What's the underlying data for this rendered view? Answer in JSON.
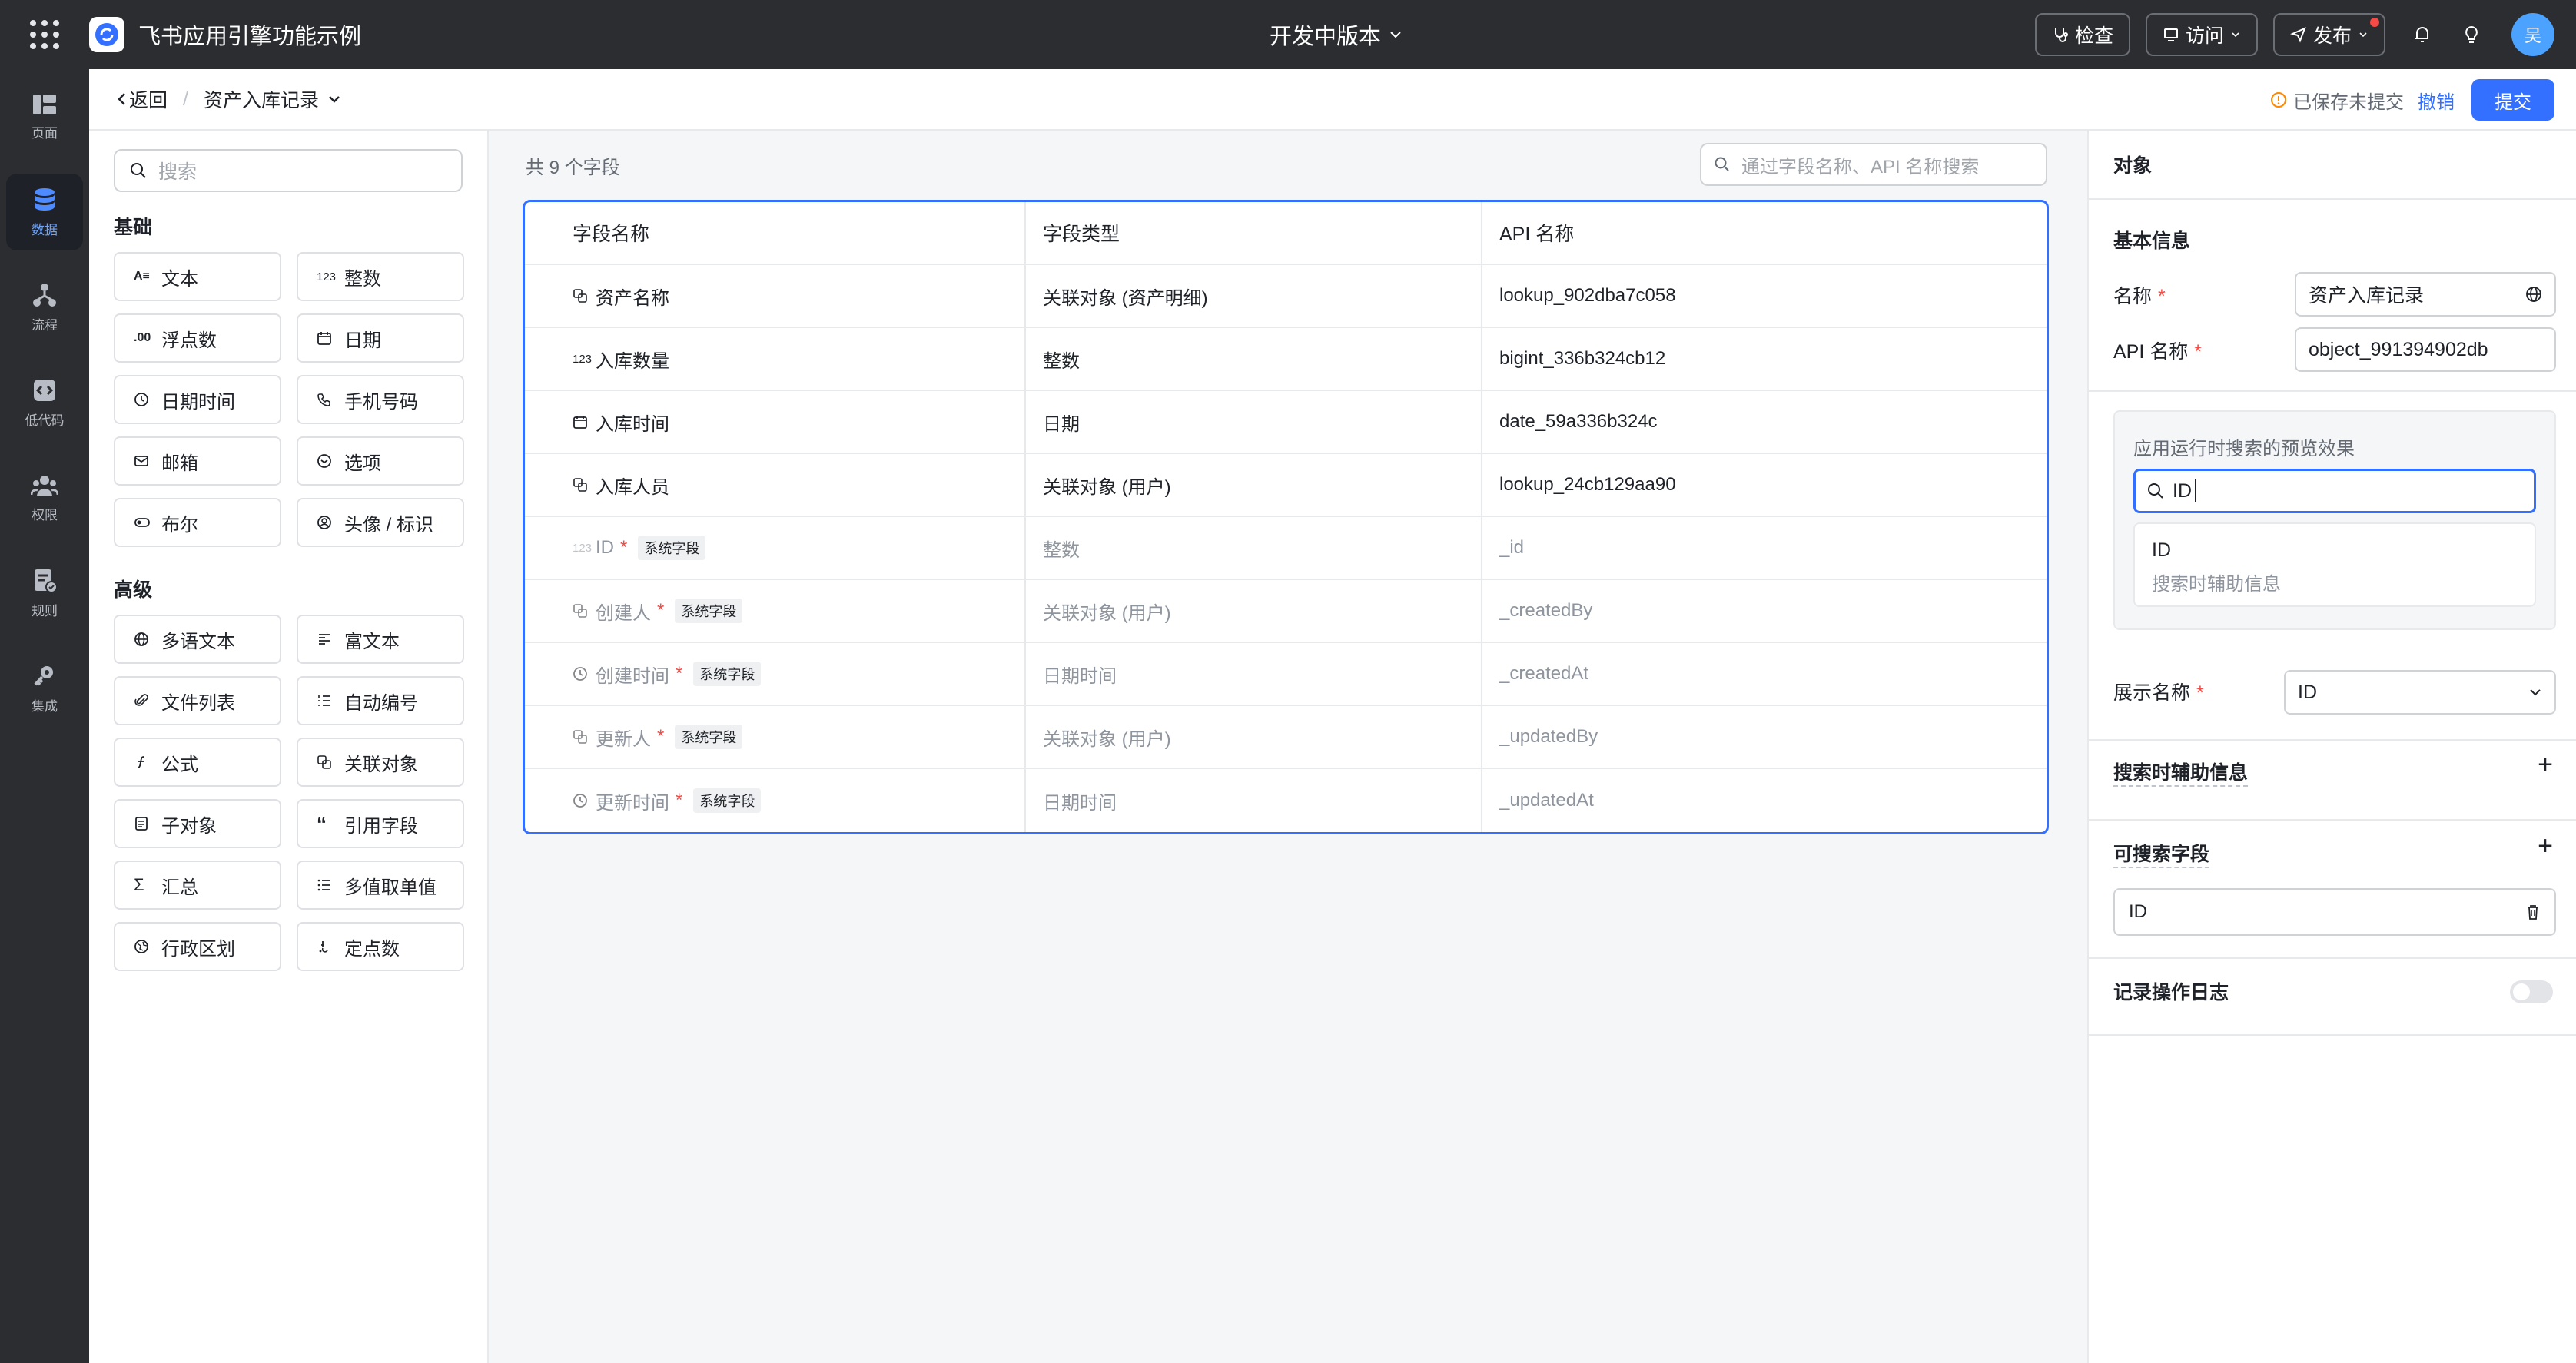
{
  "app": {
    "title": "飞书应用引擎功能示例",
    "version_label": "开发中版本",
    "buttons": {
      "inspect": "检查",
      "visit": "访问",
      "publish": "发布"
    },
    "avatar_text": "吴"
  },
  "rail": [
    {
      "label": "页面",
      "icon": "pages-icon"
    },
    {
      "label": "数据",
      "icon": "database-icon",
      "active": true
    },
    {
      "label": "流程",
      "icon": "flow-icon"
    },
    {
      "label": "低代码",
      "icon": "code-icon"
    },
    {
      "label": "权限",
      "icon": "users-icon"
    },
    {
      "label": "规则",
      "icon": "rules-icon"
    },
    {
      "label": "集成",
      "icon": "key-icon"
    }
  ],
  "breadcrumb": {
    "back": "返回",
    "separator": "/",
    "current": "资产入库记录",
    "saved_status": "已保存未提交",
    "revoke": "撤销",
    "submit": "提交"
  },
  "field_panel": {
    "search_placeholder": "搜索",
    "basic_title": "基础",
    "basic": [
      {
        "label": "文本",
        "icon": "A≡"
      },
      {
        "label": "整数",
        "icon": "123"
      },
      {
        "label": "浮点数",
        "icon": ".00"
      },
      {
        "label": "日期",
        "icon": "calendar"
      },
      {
        "label": "日期时间",
        "icon": "clock"
      },
      {
        "label": "手机号码",
        "icon": "phone"
      },
      {
        "label": "邮箱",
        "icon": "mail"
      },
      {
        "label": "选项",
        "icon": "option"
      },
      {
        "label": "布尔",
        "icon": "toggle"
      },
      {
        "label": "头像 / 标识",
        "icon": "avatar"
      }
    ],
    "advanced_title": "高级",
    "advanced": [
      {
        "label": "多语文本",
        "icon": "globe"
      },
      {
        "label": "富文本",
        "icon": "richtext"
      },
      {
        "label": "文件列表",
        "icon": "clip"
      },
      {
        "label": "自动编号",
        "icon": "list-num"
      },
      {
        "label": "公式",
        "icon": "formula"
      },
      {
        "label": "关联对象",
        "icon": "link"
      },
      {
        "label": "子对象",
        "icon": "sub"
      },
      {
        "label": "引用字段",
        "icon": "quote"
      },
      {
        "label": "汇总",
        "icon": "sigma"
      },
      {
        "label": "多值取单值",
        "icon": "list"
      },
      {
        "label": "行政区划",
        "icon": "region"
      },
      {
        "label": "定点数",
        "icon": "fixed"
      }
    ]
  },
  "table": {
    "count_label": "共 9 个字段",
    "search_placeholder": "通过字段名称、API 名称搜索",
    "headers": [
      "字段名称",
      "字段类型",
      "API 名称"
    ],
    "rows": [
      {
        "name": "资产名称",
        "icon": "link",
        "type": "关联对象 (资产明细)",
        "api": "lookup_902dba7c058",
        "sys": false,
        "required": false
      },
      {
        "name": "入库数量",
        "icon": "123",
        "type": "整数",
        "api": "bigint_336b324cb12",
        "sys": false,
        "required": false
      },
      {
        "name": "入库时间",
        "icon": "calendar",
        "type": "日期",
        "api": "date_59a336b324c",
        "sys": false,
        "required": false
      },
      {
        "name": "入库人员",
        "icon": "link",
        "type": "关联对象 (用户)",
        "api": "lookup_24cb129aa90",
        "sys": false,
        "required": false
      },
      {
        "name": "ID",
        "icon": "123",
        "type": "整数",
        "api": "_id",
        "sys": true,
        "required": true
      },
      {
        "name": "创建人",
        "icon": "link",
        "type": "关联对象 (用户)",
        "api": "_createdBy",
        "sys": true,
        "required": true
      },
      {
        "name": "创建时间",
        "icon": "clock",
        "type": "日期时间",
        "api": "_createdAt",
        "sys": true,
        "required": true
      },
      {
        "name": "更新人",
        "icon": "link",
        "type": "关联对象 (用户)",
        "api": "_updatedBy",
        "sys": true,
        "required": true
      },
      {
        "name": "更新时间",
        "icon": "clock",
        "type": "日期时间",
        "api": "_updatedAt",
        "sys": true,
        "required": true
      }
    ],
    "sys_tag": "系统字段",
    "required_mark": "*"
  },
  "right_panel": {
    "title": "对象",
    "basic_info": "基本信息",
    "name_label": "名称",
    "name_value": "资产入库记录",
    "api_label": "API 名称",
    "api_value": "object_991394902db",
    "preview_title": "应用运行时搜索的预览效果",
    "preview_input": "ID",
    "preview_result_title": "ID",
    "preview_result_sub": "搜索时辅助信息",
    "display_name_label": "展示名称",
    "display_name_value": "ID",
    "search_aux_label": "搜索时辅助信息",
    "searchable_label": "可搜索字段",
    "searchable_value": "ID",
    "log_label": "记录操作日志",
    "required_mark": "*"
  },
  "colors": {
    "primary": "#3370ff",
    "topbar": "#2b2d31",
    "required": "#f54a45"
  }
}
